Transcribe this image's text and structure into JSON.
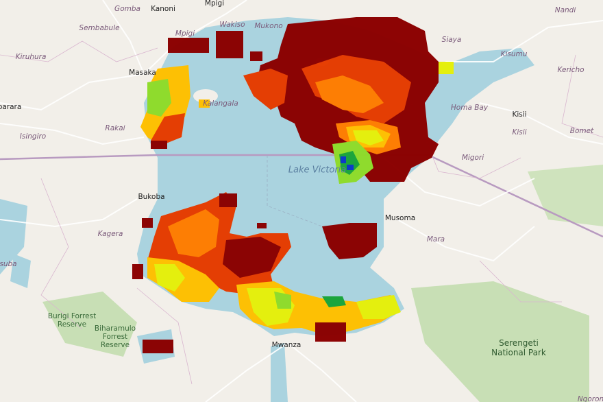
{
  "labels": {
    "gomba": "Gomba",
    "kanoni": "Kanoni",
    "mpigi": "Mpigi",
    "nandi": "Nandi",
    "sembabule": "Sembabule",
    "mpigi2": "Mpigi",
    "wakiso": "Wakiso",
    "mukono": "Mukono",
    "siaya": "Siaya",
    "kiruhura": "Kiruhura",
    "masaka": "Masaka",
    "kisumu": "Kisumu",
    "kericho": "Kericho",
    "mbarara": "barara",
    "kalangala": "Kalangala",
    "homa_bay": "Homa Bay",
    "kisii": "Kisii",
    "kisii2": "Kisii",
    "rakai": "Rakai",
    "bomet": "Bomet",
    "isingiro": "Isingiro",
    "migori": "Migori",
    "lake_victoria": "Lake Victoria",
    "bukoba": "Bukoba",
    "musoma": "Musoma",
    "kagera": "Kagera",
    "mara": "Mara",
    "isuba": "suba",
    "mwanza": "Mwanza",
    "burigi": "Burigi Forrest Reserve",
    "biharamulo": "Biharamulo Forrest Reserve",
    "serengeti": "Serengeti National Park",
    "ngorongoro": "Ngoron"
  },
  "colors": {
    "land": "#f2efe9",
    "water": "#aad3df",
    "boundary": "#b89ac0",
    "road": "#ffffff",
    "park": "#c8dfb5",
    "precip_scale": [
      "#0a38c8",
      "#1aa53a",
      "#8fdc2a",
      "#e6f00a",
      "#ffc000",
      "#ff7d00",
      "#e63c00",
      "#8b0000"
    ]
  }
}
